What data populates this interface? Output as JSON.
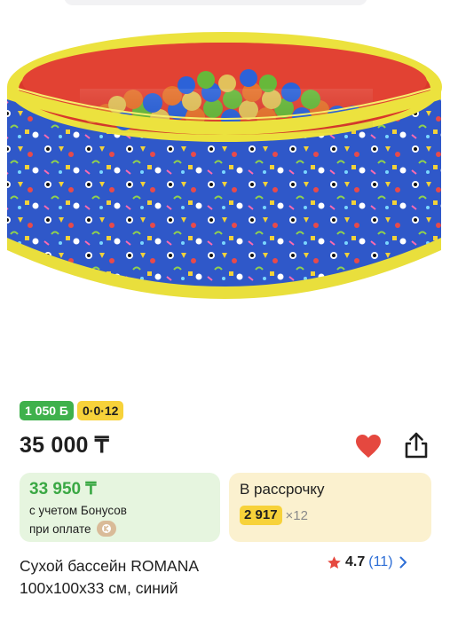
{
  "product": {
    "image_alt": "Сухой бассейн ROMANA с шариками",
    "badges": {
      "bonus": "1 050 Б",
      "installment": "0·0·12"
    },
    "price": "35 000 ₸",
    "bonus_card": {
      "price": "33 950 ₸",
      "note_line1": "с учетом Бонусов",
      "note_line2": "при оплате"
    },
    "credit_card": {
      "title": "В рассрочку",
      "monthly": "2 917",
      "months": "×12"
    },
    "title_line1": "Сухой бассейн ROMANA",
    "title_line2": "100x100x33 см, синий",
    "rating": {
      "value": "4.7",
      "count": "(11)"
    }
  },
  "colors": {
    "green": "#3fb14c",
    "yellow": "#f7d23a",
    "heart_red": "#e5483f",
    "link_blue": "#2f6fd6"
  },
  "icons": [
    "heart-icon",
    "share-icon",
    "star-icon",
    "chevron-right-icon",
    "kaspi-icon"
  ]
}
